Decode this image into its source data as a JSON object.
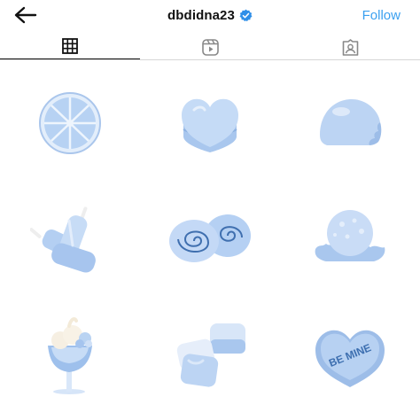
{
  "header": {
    "back_icon": "arrow-left-icon",
    "username": "dbdidna23",
    "verified_icon": "verified-badge-icon",
    "follow_label": "Follow"
  },
  "tabs": [
    {
      "icon": "grid-icon",
      "active": true
    },
    {
      "icon": "reels-icon",
      "active": false
    },
    {
      "icon": "tagged-icon",
      "active": false
    }
  ],
  "grid": {
    "items": [
      {
        "subject": "lemon-slice"
      },
      {
        "subject": "heart-cake"
      },
      {
        "subject": "bitten-mochi"
      },
      {
        "subject": "ice-pops"
      },
      {
        "subject": "swiss-rolls"
      },
      {
        "subject": "ice-cream-scoop"
      },
      {
        "subject": "parfait-glass"
      },
      {
        "subject": "marshmallows"
      },
      {
        "subject": "candy-heart"
      }
    ],
    "candy_heart_text": "BE MINE"
  },
  "colors": {
    "accent": "#3aa0f0",
    "verified": "#2f8fe8",
    "item_blue": "#b9d3f2",
    "item_light": "#dbe8f8",
    "item_dark": "#8fb3e2"
  }
}
